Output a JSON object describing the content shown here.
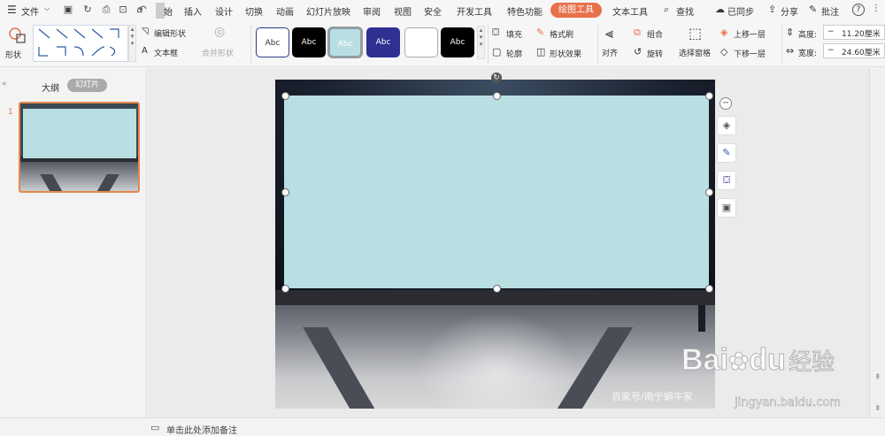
{
  "menubar": {
    "file_label": "文件",
    "menus": [
      "插入",
      "设计",
      "切换",
      "动画",
      "幻灯片放映",
      "审阅",
      "视图",
      "安全",
      "开发工具",
      "特色功能"
    ],
    "active_tab": "绘图工具",
    "text_tool": "文本工具",
    "search": "查找",
    "sync": "已同步",
    "share": "分享",
    "comment": "批注",
    "help": "?",
    "truncated": "始"
  },
  "ribbon": {
    "shape": "形状",
    "edit_shape": "编辑形状",
    "text_box": "文本框",
    "merge_shape": "合并形状",
    "style_samples": [
      "Abc",
      "Abc",
      "Abc",
      "Abc",
      "",
      "Abc"
    ],
    "fill": "填充",
    "format_painter": "格式刷",
    "outline": "轮廓",
    "shape_effect": "形状效果",
    "align": "对齐",
    "group": "组合",
    "rotate": "旋转",
    "select_pane": "选择窗格",
    "bring_forward": "上移一层",
    "send_backward": "下移一层",
    "height_label": "高度:",
    "height_value": "11.20厘米",
    "width_label": "宽度:",
    "width_value": "24.60厘米",
    "minus": "−"
  },
  "panel": {
    "outline_tab": "大纲",
    "slides_tab": "幻灯片",
    "slide_number": "1",
    "add_slide": "+"
  },
  "status": {
    "notes_placeholder": "单击此处添加备注"
  },
  "watermark": {
    "text1": "百家号/南宁蜗牛家",
    "baidu": "Bai",
    "du": "du",
    "jingyan": "经验",
    "site": "jingyan.baidu.com"
  },
  "colors": {
    "accent": "#e8704a",
    "shape_fill": "#b9dfe2",
    "selected_border": "#e8884a"
  }
}
